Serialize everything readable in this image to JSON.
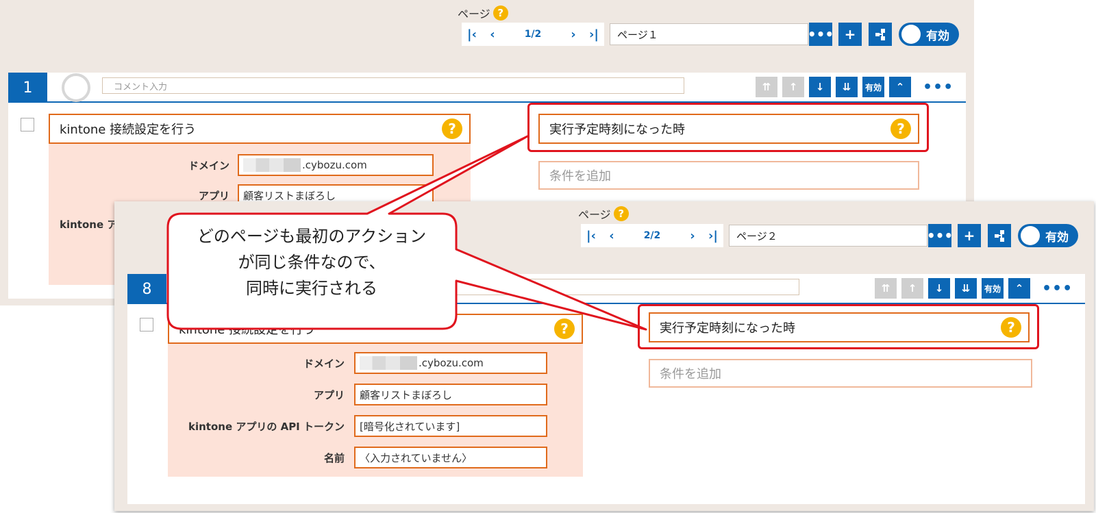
{
  "panel_top": {
    "page_label": "ページ",
    "nav": {
      "first": "|<",
      "prev": "<",
      "count": "1/2",
      "next": ">",
      "last": ">|"
    },
    "page_name": "ページ１",
    "toggle_label": "有効",
    "step": {
      "number": "1",
      "comment_placeholder": "コメント入力",
      "toolbar": {
        "enabled_label": "有効"
      },
      "action_title": "kintone 接続設定を行う",
      "fields": [
        {
          "label": "ドメイン",
          "value": ".cybozu.com"
        },
        {
          "label": "アプリ",
          "value": "顧客リストまぼろし"
        },
        {
          "label": "kintone ア",
          "value": ""
        }
      ],
      "condition_title": "実行予定時刻になった時",
      "add_condition": "条件を追加"
    }
  },
  "panel_bottom": {
    "page_label": "ページ",
    "nav": {
      "first": "|<",
      "prev": "<",
      "count": "2/2",
      "next": ">",
      "last": ">|"
    },
    "page_name": "ページ２",
    "toggle_label": "有効",
    "step": {
      "number": "8",
      "toolbar": {
        "enabled_label": "有効"
      },
      "action_title": "kintone 接続設定を行う",
      "fields": [
        {
          "label": "ドメイン",
          "value": ".cybozu.com"
        },
        {
          "label": "アプリ",
          "value": "顧客リストまぼろし"
        },
        {
          "label": "kintone アプリの API トークン",
          "value": "[暗号化されています]"
        },
        {
          "label": "名前",
          "value": "〈入力されていません〉"
        }
      ],
      "condition_title": "実行予定時刻になった時",
      "add_condition": "条件を追加"
    }
  },
  "callout": {
    "lines": [
      "どのページも最初のアクション",
      "が同じ条件なので、",
      "同時に実行される"
    ]
  },
  "colors": {
    "accent_blue": "#0c67b5",
    "highlight_red": "#e0141e",
    "action_orange": "#e06a1b",
    "help_yellow": "#f6b400"
  },
  "icons": [
    "help-icon",
    "first-page-icon",
    "prev-page-icon",
    "next-page-icon",
    "last-page-icon",
    "more-icon",
    "plus-icon",
    "flow-icon",
    "move-top-icon",
    "move-up-icon",
    "move-down-icon",
    "move-bottom-icon",
    "collapse-icon"
  ]
}
